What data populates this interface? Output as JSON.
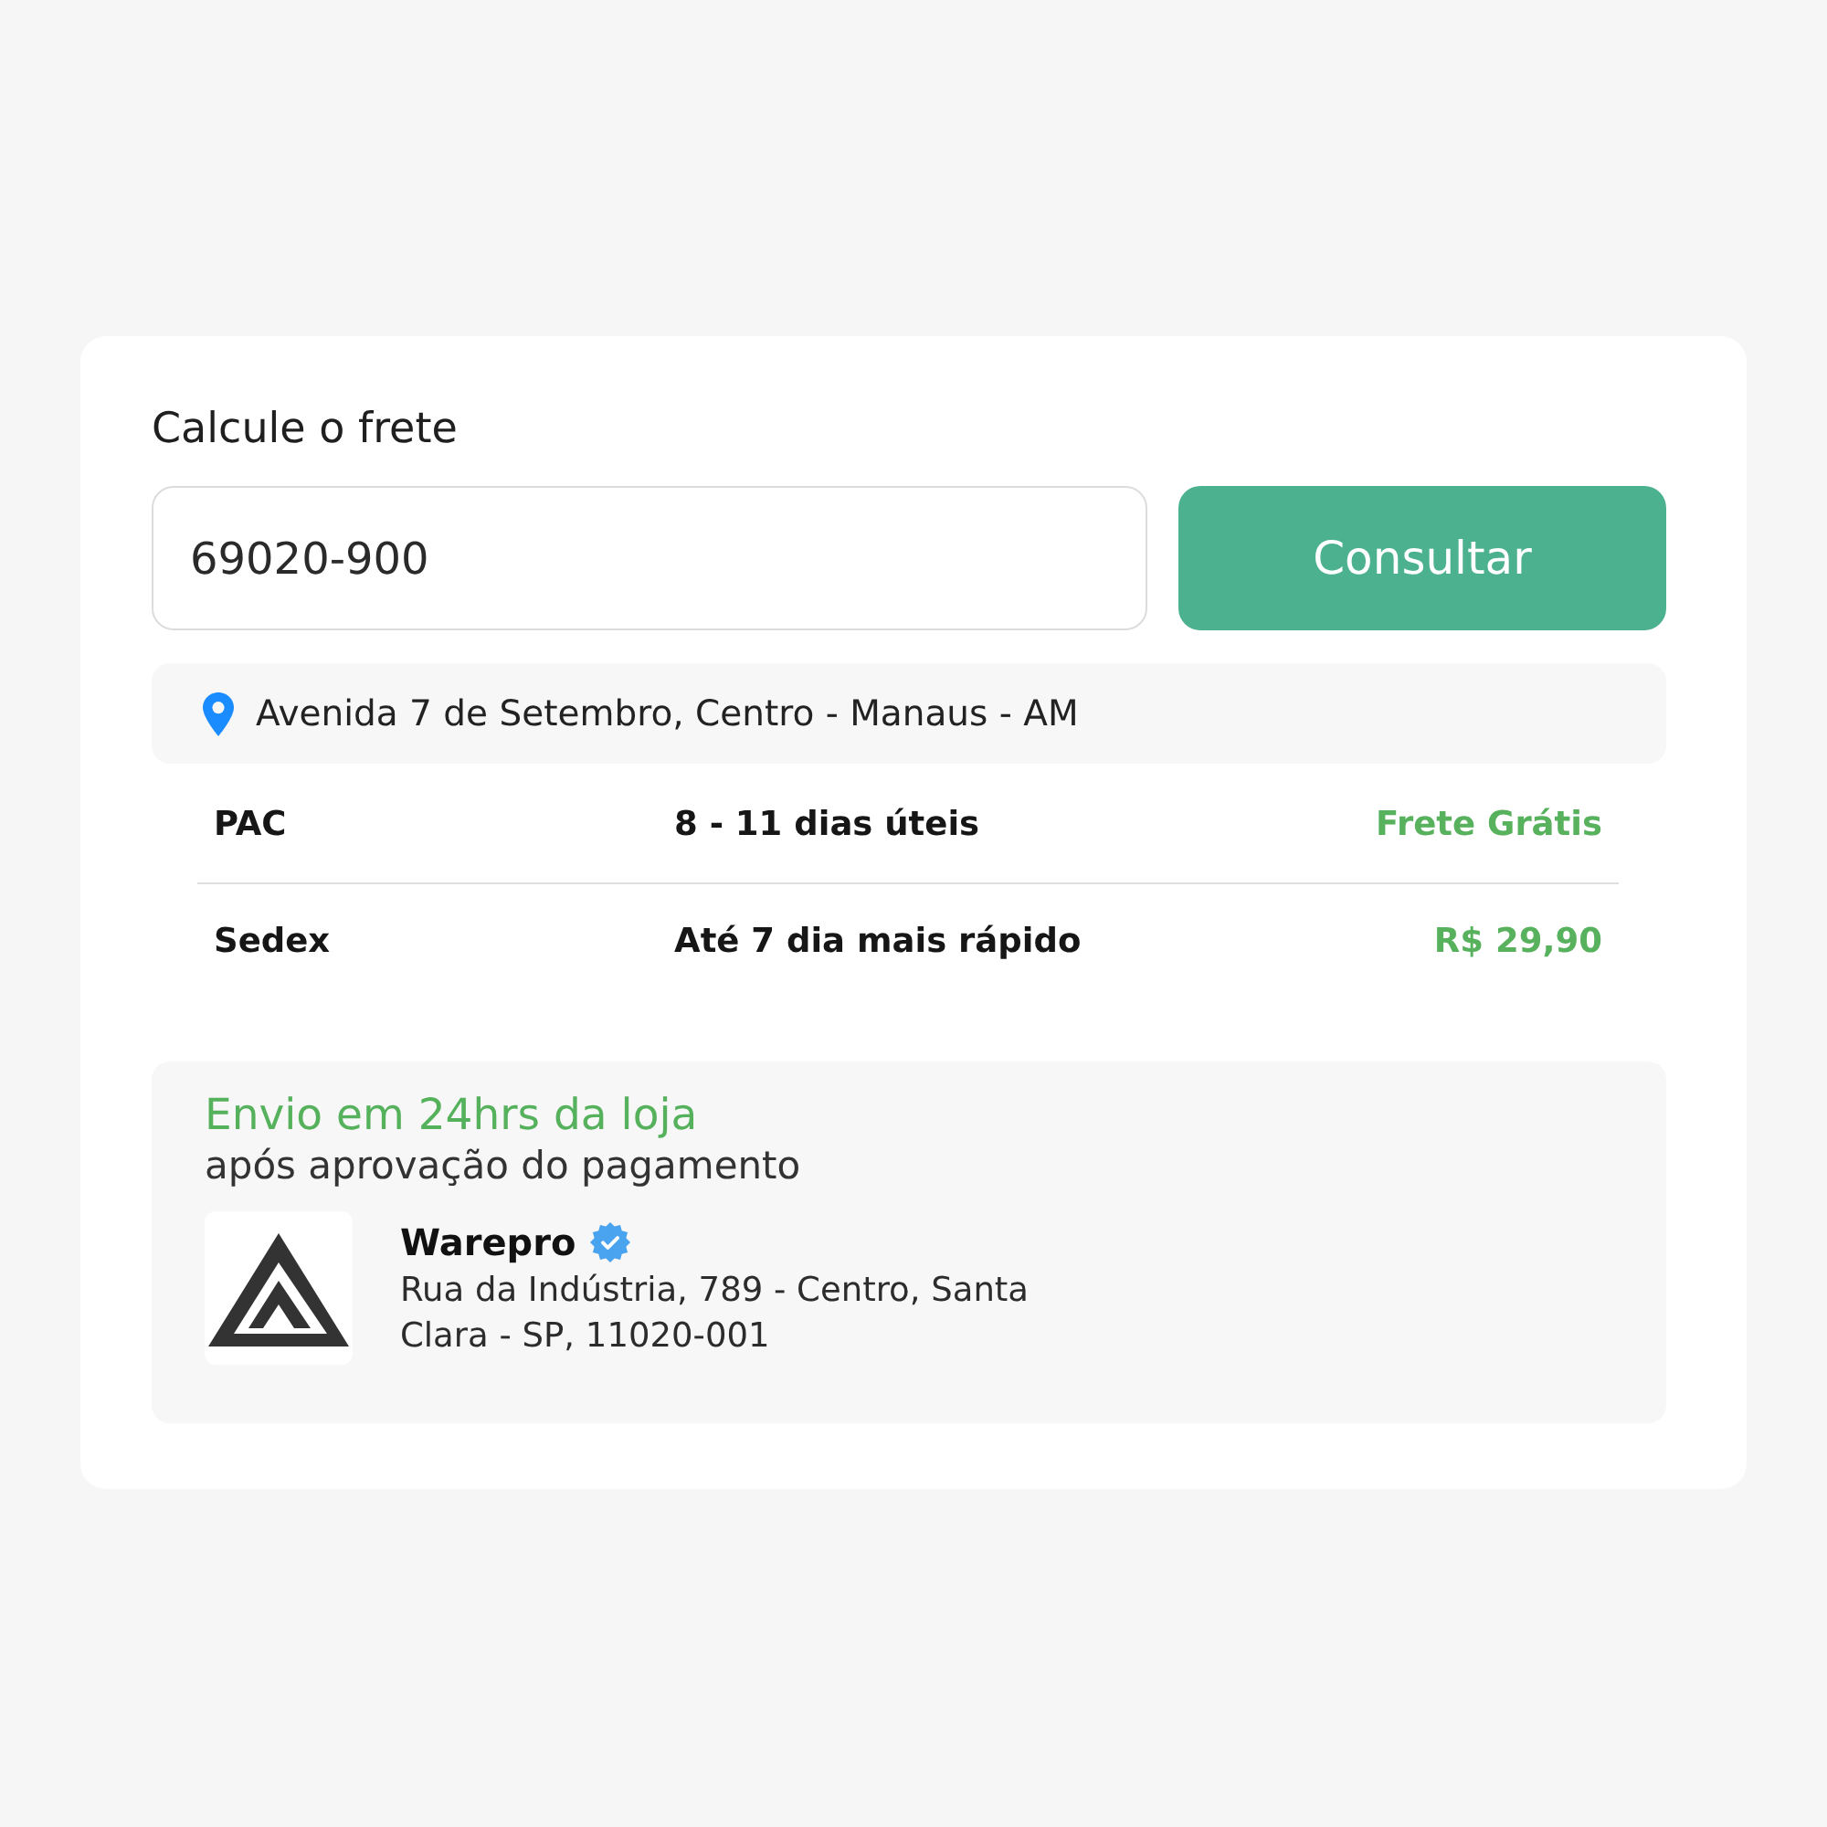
{
  "title": "Calcule o frete",
  "cep_field": {
    "value": "69020-900"
  },
  "submit_button": {
    "label": "Consultar"
  },
  "address": {
    "text": "Avenida 7 de Setembro, Centro - Manaus - AM"
  },
  "shipping_options": [
    {
      "service": "PAC",
      "delivery_time": "8 - 11 dias úteis",
      "price": "Frete Grátis"
    },
    {
      "service": "Sedex",
      "delivery_time": "Até 7 dia mais rápido",
      "price": "R$ 29,90"
    }
  ],
  "store_pickup": {
    "headline": "Envio em 24hrs da loja",
    "subtitle": "após aprovação do pagamento",
    "store": {
      "name": "Warepro",
      "verified": true,
      "address": "Rua da Indústria, 789 - Centro, Santa Clara - SP, 11020-001"
    }
  }
}
